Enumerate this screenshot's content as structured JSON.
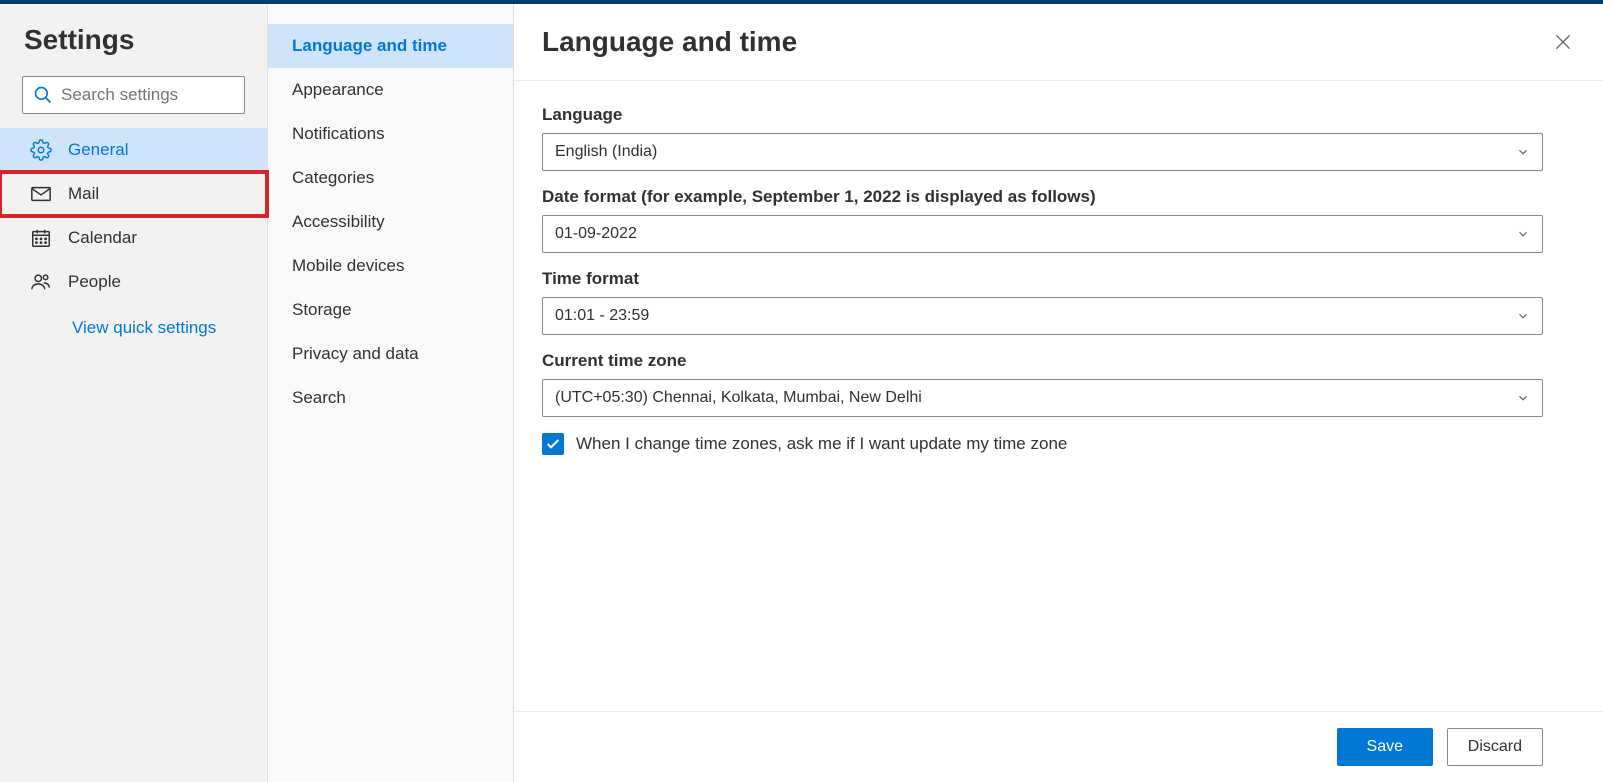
{
  "sidebar": {
    "title": "Settings",
    "search_placeholder": "Search settings",
    "items": [
      {
        "label": "General",
        "icon": "gear"
      },
      {
        "label": "Mail",
        "icon": "mail"
      },
      {
        "label": "Calendar",
        "icon": "calendar"
      },
      {
        "label": "People",
        "icon": "people"
      }
    ],
    "quick_link": "View quick settings"
  },
  "subnav": {
    "items": [
      "Language and time",
      "Appearance",
      "Notifications",
      "Categories",
      "Accessibility",
      "Mobile devices",
      "Storage",
      "Privacy and data",
      "Search"
    ]
  },
  "main": {
    "title": "Language and time",
    "language_label": "Language",
    "language_value": "English (India)",
    "date_label": "Date format (for example, September 1, 2022 is displayed as follows)",
    "date_value": "01-09-2022",
    "time_label": "Time format",
    "time_value": "01:01 - 23:59",
    "tz_label": "Current time zone",
    "tz_value": "(UTC+05:30) Chennai, Kolkata, Mumbai, New Delhi",
    "tz_checkbox": "When I change time zones, ask me if I want update my time zone",
    "save": "Save",
    "discard": "Discard"
  }
}
